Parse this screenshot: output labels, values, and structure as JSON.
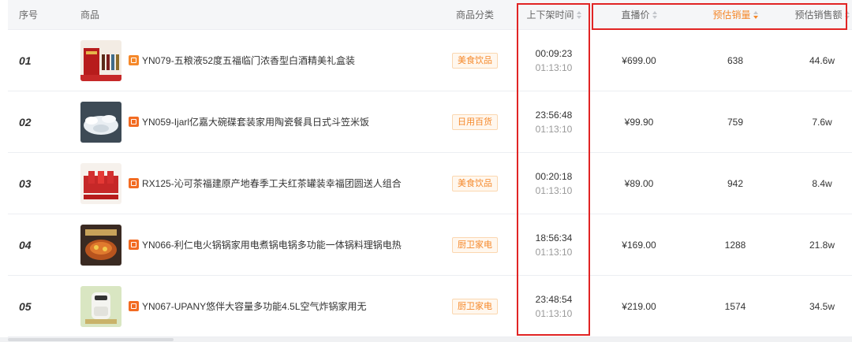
{
  "colors": {
    "accent": "#f5882a",
    "highlight_border": "#e12424",
    "header_bg": "#f5f6f8"
  },
  "header": {
    "seq": "序号",
    "product": "商品",
    "category": "商品分类",
    "time": "上下架时间",
    "price": "直播价",
    "sales": "预估销量",
    "amount": "预估销售额"
  },
  "rows": [
    {
      "seq": "01",
      "name": "YN079-五粮液52度五福临门浓香型白酒精美礼盒装",
      "category": "美食饮品",
      "time_on": "00:09:23",
      "time_off": "01:13:10",
      "price": "¥699.00",
      "sales": "638",
      "amount": "44.6w",
      "thumb_icon": "liquor-giftbox-icon"
    },
    {
      "seq": "02",
      "name": "YN059-Ijarl亿嘉大碗碟套装家用陶瓷餐具日式斗笠米饭",
      "category": "日用百货",
      "time_on": "23:56:48",
      "time_off": "01:13:10",
      "price": "¥99.90",
      "sales": "759",
      "amount": "7.6w",
      "thumb_icon": "tableware-set-icon"
    },
    {
      "seq": "03",
      "name": "RX125-沁可茶福建原产地春季工夫红茶罐装幸福团圆送人组合",
      "category": "美食饮品",
      "time_on": "00:20:18",
      "time_off": "01:13:10",
      "price": "¥89.00",
      "sales": "942",
      "amount": "8.4w",
      "thumb_icon": "tea-giftbox-icon"
    },
    {
      "seq": "04",
      "name": "YN066-利仁电火锅锅家用电煮锅电锅多功能一体锅料理锅电热",
      "category": "厨卫家电",
      "time_on": "18:56:34",
      "time_off": "01:13:10",
      "price": "¥169.00",
      "sales": "1288",
      "amount": "21.8w",
      "thumb_icon": "hotpot-icon"
    },
    {
      "seq": "05",
      "name": "YN067-UPANY悠伴大容量多功能4.5L空气炸锅家用无",
      "category": "厨卫家电",
      "time_on": "23:48:54",
      "time_off": "01:13:10",
      "price": "¥219.00",
      "sales": "1574",
      "amount": "34.5w",
      "thumb_icon": "air-fryer-icon"
    }
  ]
}
